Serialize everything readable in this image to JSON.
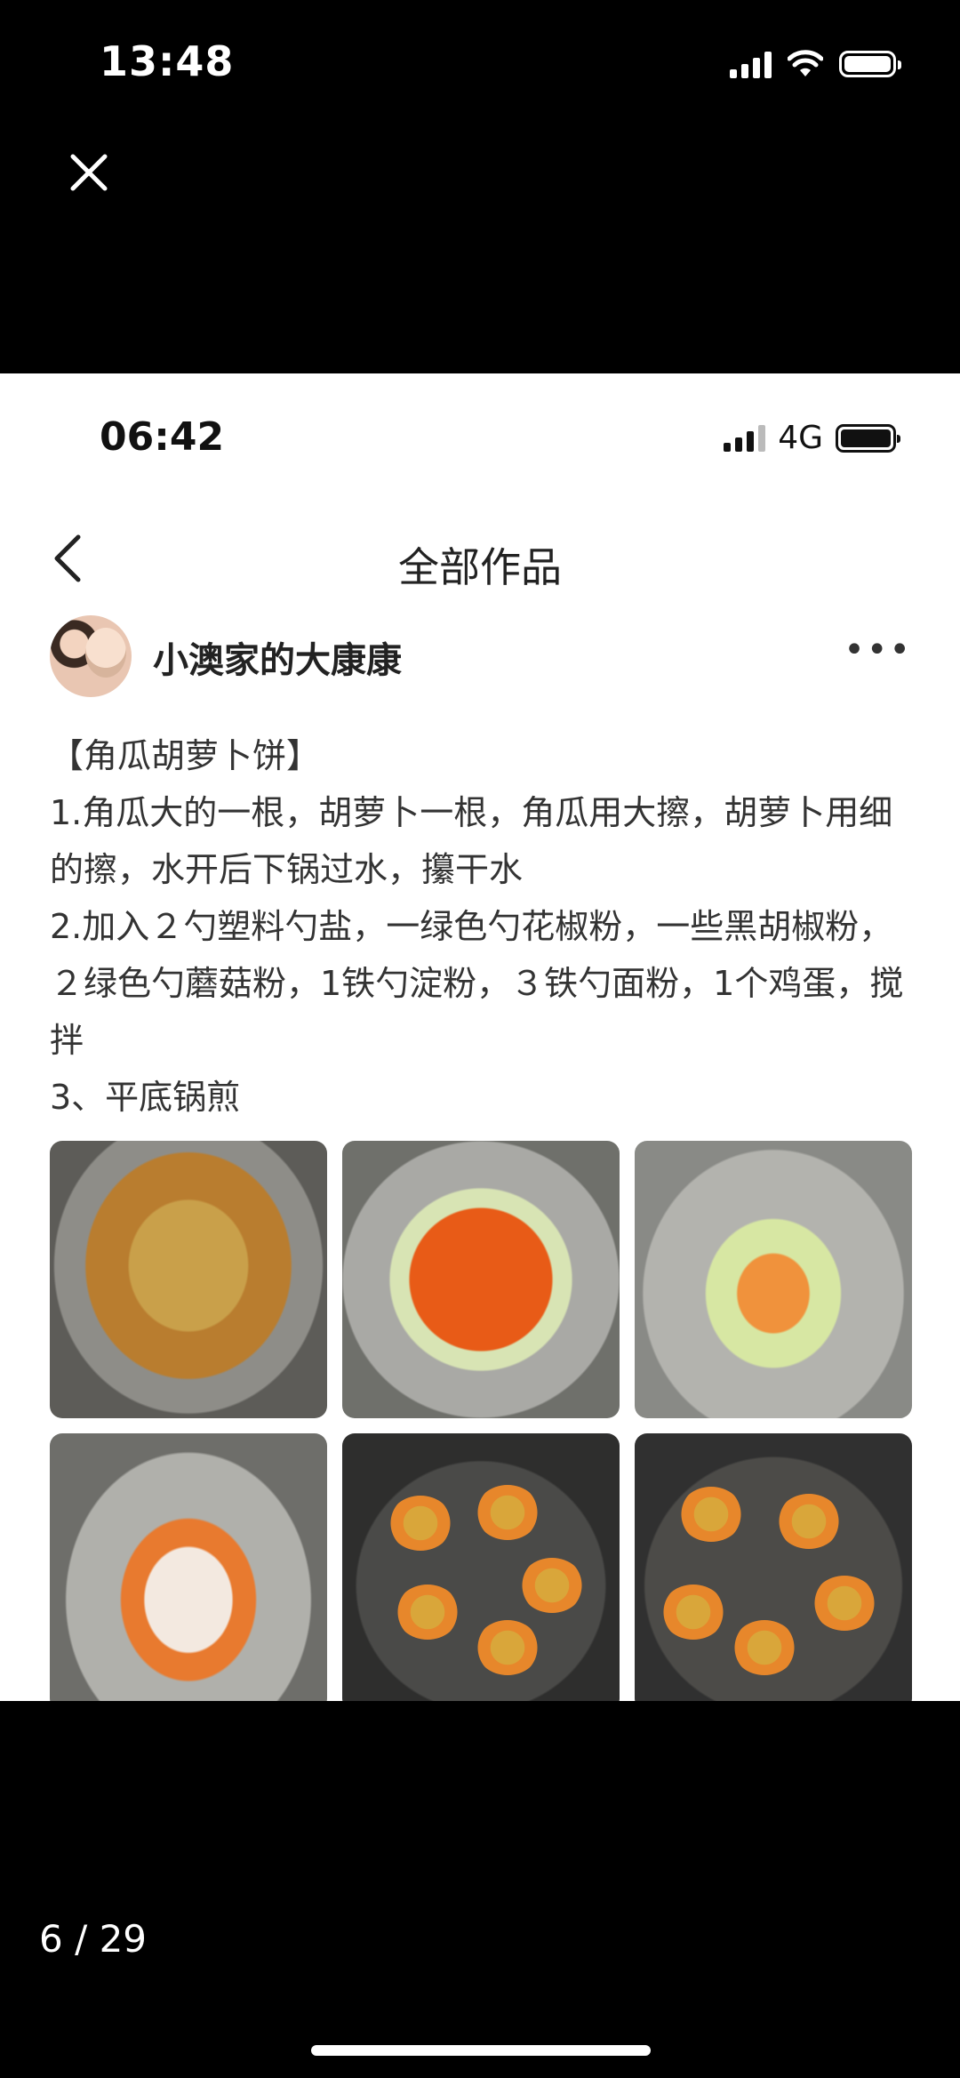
{
  "viewer": {
    "status_time": "13:48",
    "close_icon": "close-icon",
    "page_counter": "6 / 29"
  },
  "screenshot": {
    "status_time": "06:42",
    "network": "4G",
    "nav_title": "全部作品",
    "author_name": "小澳家的大康康",
    "post_lines": [
      "【角瓜胡萝卜饼】",
      "1.角瓜大的一根，胡萝卜一根，角瓜用大擦，胡萝卜用细的擦，水开后下锅过水，攥干水",
      "2.加入２勺塑料勺盐，一绿色勺花椒粉，一些黑胡椒粉，２绿色勺蘑菇粉，1铁勺淀粉，３铁勺面粉，1个鸡蛋，搅拌",
      "3、平底锅煎"
    ]
  },
  "colors": {
    "viewer_bg": "#000000",
    "screenshot_bg": "#ffffff"
  }
}
